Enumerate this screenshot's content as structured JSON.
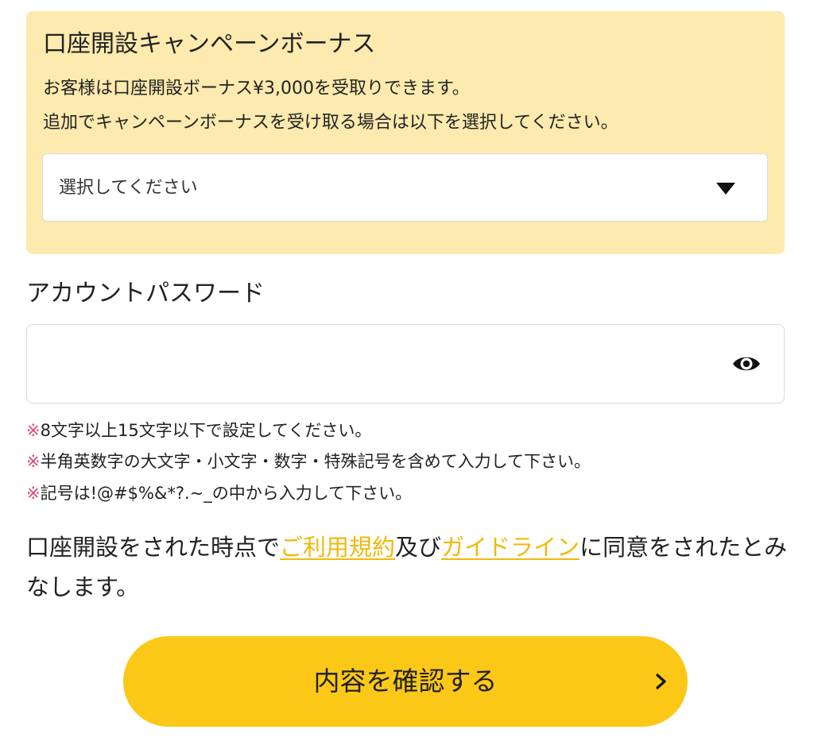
{
  "bonus_section": {
    "title": "口座開設キャンペーンボーナス",
    "description_line1": "お客様は口座開設ボーナス¥3,000を受取りできます。",
    "description_line2": "追加でキャンペーンボーナスを受け取る場合は以下を選択してください。",
    "select": {
      "selected_value": "選択してください",
      "icon": "triangle-down-icon"
    }
  },
  "password_section": {
    "label": "アカウントパスワード",
    "value": "",
    "toggle_icon": "eye-icon",
    "notes": [
      {
        "mark": "※",
        "text": "8文字以上15文字以下で設定してください。"
      },
      {
        "mark": "※",
        "text": "半角英数字の大文字・小文字・数字・特殊記号を含めて入力して下さい。"
      },
      {
        "mark": "※",
        "text": "記号は!@#$%&*?.~_の中から入力して下さい。"
      }
    ]
  },
  "agreement": {
    "text_before": "口座開設をされた時点で",
    "terms_link": "ご利用規約",
    "text_middle": "及び",
    "guideline_link": "ガイドライン",
    "text_after": "に同意をされたとみなします。"
  },
  "confirm_button": {
    "label": "内容を確認する",
    "icon": "chevron-right-icon"
  },
  "colors": {
    "panel_background": "#fdeaae",
    "accent_yellow": "#fcc818",
    "link": "#f0b90b",
    "note_mark": "#e0457b"
  }
}
